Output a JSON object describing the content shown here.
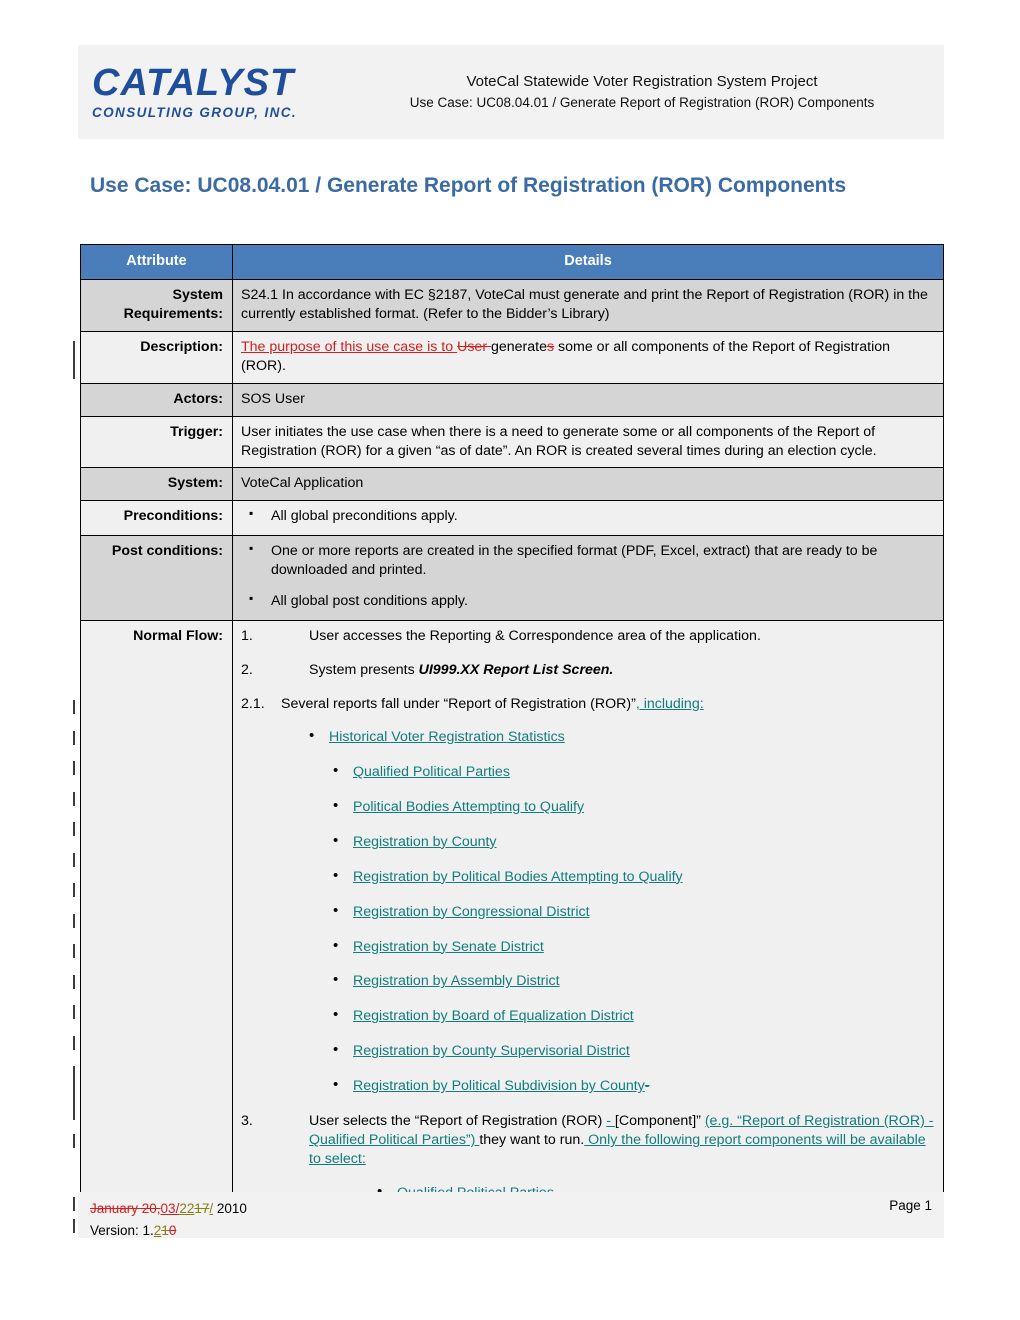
{
  "header": {
    "logo_main": "CATALYST",
    "logo_sub": "CONSULTING GROUP, INC.",
    "line1": "VoteCal Statewide Voter Registration System Project",
    "line2": "Use Case: UC08.04.01 / Generate Report of Registration (ROR) Components"
  },
  "title": "Use Case: UC08.04.01 / Generate Report of Registration (ROR) Components",
  "table": {
    "col_attribute": "Attribute",
    "col_details": "Details",
    "rows": {
      "system_requirements": {
        "label": "System Requirements:",
        "text": "S24.1 In accordance with EC §2187, VoteCal must generate and print the Report of Registration (ROR) in the currently established format. (Refer to the Bidder’s Library)"
      },
      "description": {
        "label": "Description:",
        "ins1": "The purpose of this use case is to ",
        "del1": "User ",
        "plain1": "generate",
        "del2": "s",
        "plain2": " some or all components of the Report of Registration (ROR).",
        "ins2": " "
      },
      "actors": {
        "label": "Actors:",
        "text": "SOS User"
      },
      "trigger": {
        "label": "Trigger:",
        "text": "User initiates the use case when there is a need to generate some or all components of the Report of Registration (ROR) for a given “as of date”. An ROR is created several times during an election cycle."
      },
      "system": {
        "label": "System:",
        "text": "VoteCal Application"
      },
      "preconditions": {
        "label": "Preconditions:",
        "items": [
          "All global preconditions apply."
        ]
      },
      "postconditions": {
        "label": "Post conditions:",
        "items": [
          "One or more reports are created in the specified format (PDF, Excel, extract) that are ready to be downloaded and printed.",
          "All global post conditions apply."
        ]
      },
      "normal_flow": {
        "label": "Normal Flow:",
        "step1_num": "1.",
        "step1_text": "User accesses the Reporting & Correspondence area of the application.",
        "step2_num": "2.",
        "step2_pre": "System presents ",
        "step2_bold": "UI999.XX Report List Screen.",
        "step2_1_num": "2.1.",
        "step2_1_text": "Several reports fall under “Report of Registration (ROR)”",
        "step2_1_ins": ", including:",
        "report_list_first": "Historical Voter Registration Statistics",
        "report_list": [
          "Qualified Political Parties",
          "Political Bodies Attempting to Qualify",
          "Registration by County",
          "Registration by Political Bodies Attempting to Qualify",
          "Registration by Congressional District",
          "Registration by Senate District",
          "Registration by Assembly District",
          "Registration by Board of Equalization District",
          "Registration by County Supervisorial District",
          "Registration by Political Subdivision by County"
        ],
        "report_list_last_del": "-",
        "step3_num": "3.",
        "step3_p1": "User selects the “Report of Registration (ROR) ",
        "step3_ins1": "- ",
        "step3_p2": "[Component]” ",
        "step3_ins2": "(e.g. “Report of Registration (ROR) - Qualified Political Parties”) ",
        "step3_p3": "they want to run.",
        "step3_ins3": " Only the following report components will be available to select:",
        "step3_bullets": [
          "Qualified Political Parties"
        ]
      }
    }
  },
  "footer": {
    "date_del1": "January 20,",
    "date_ins1": "03/",
    "date_ins2": "22",
    "date_del2": "17",
    "date_ins3": "/",
    "date_year": " 2010",
    "version_label": "Version: 1.",
    "version_ins": "2",
    "version_del1": "1",
    "version_del2": "0",
    "page_label": "Page ",
    "page_number": "1"
  },
  "colors": {
    "header_blue": "#4a7ebb",
    "title_blue": "#3b6ba5",
    "logo_blue": "#1f4e9c",
    "insert_red": "#d21f1f",
    "insert_teal": "#117d7d",
    "insert_olive": "#8a7f1b"
  }
}
